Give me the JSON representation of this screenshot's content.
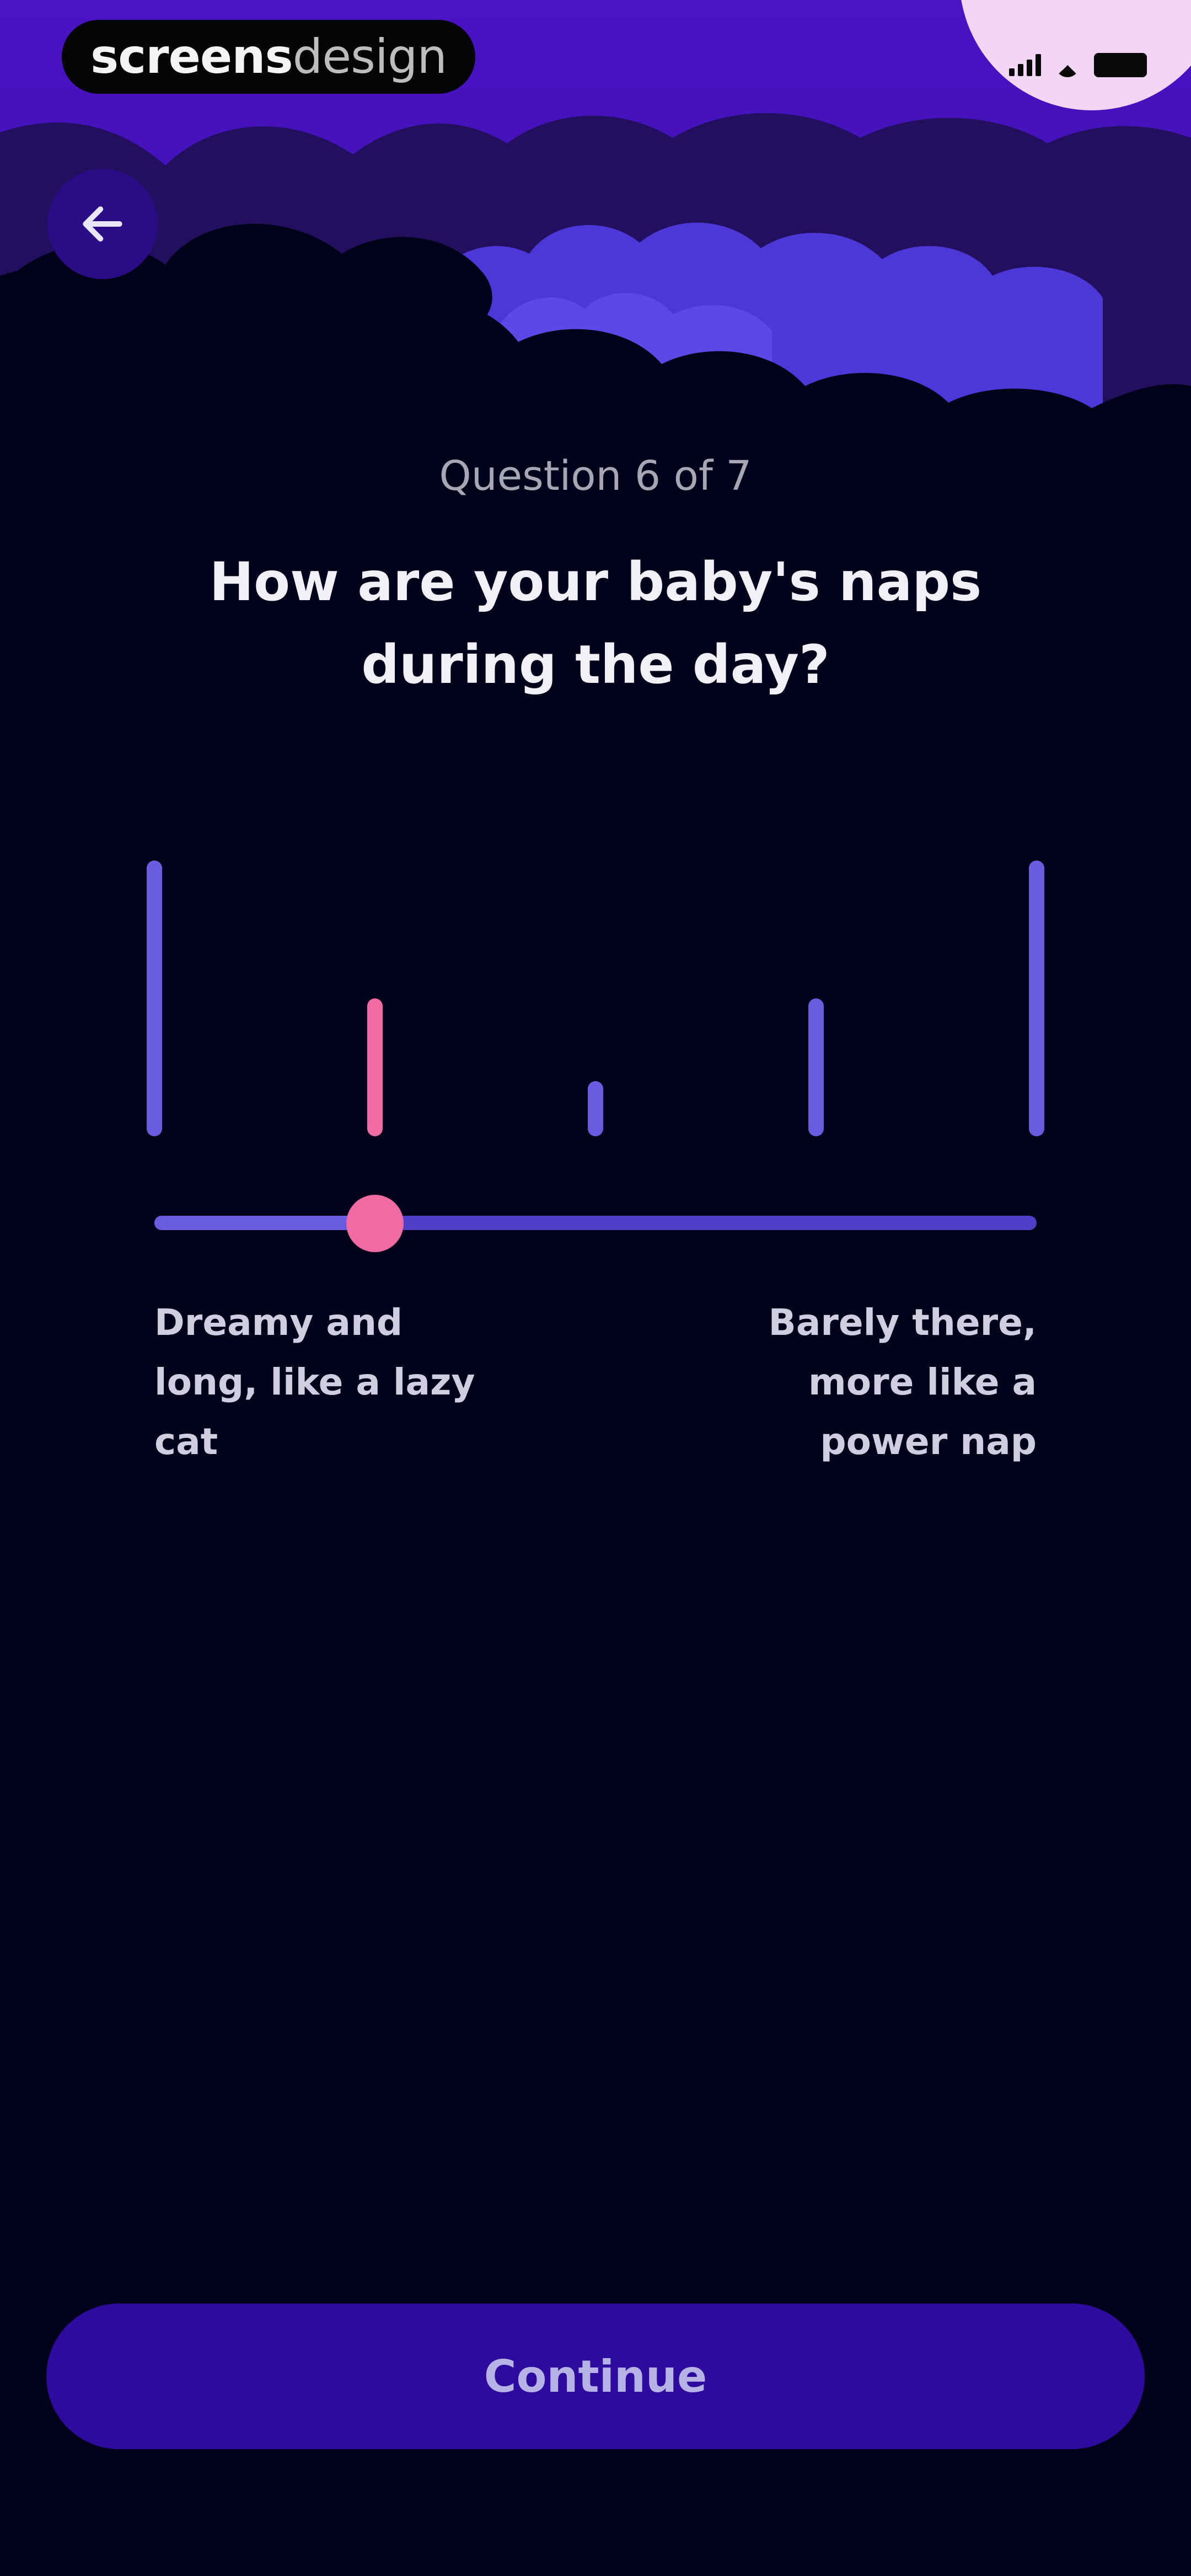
{
  "app": {
    "brand_part1": "screens",
    "brand_part2": "design"
  },
  "navigation": {
    "back_icon": "arrow-left-icon"
  },
  "question": {
    "progress": "Question 6 of 7",
    "title": "How are your baby's naps during the day?"
  },
  "scale": {
    "left_label": "Dreamy and long, like a lazy cat",
    "right_label": "Barely there, more like a power nap",
    "options": [
      {
        "level": 1.0
      },
      {
        "level": 0.5
      },
      {
        "level": 0.2
      },
      {
        "level": 0.5
      },
      {
        "level": 1.0
      }
    ],
    "selected_index": 1,
    "selected_fraction": 0.25
  },
  "actions": {
    "continue_label": "Continue"
  },
  "colors": {
    "background": "#02011a",
    "bar": "#6a5ce0",
    "bar_selected": "#f06aa3",
    "accent": "#2e0a9e",
    "thumb": "#f06aa3"
  }
}
